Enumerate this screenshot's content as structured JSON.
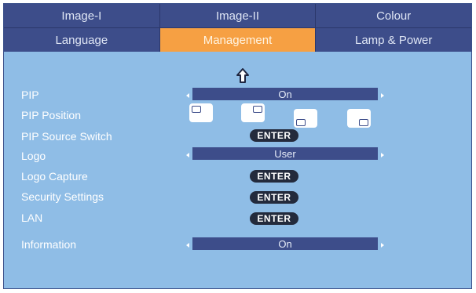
{
  "tabs_row1": [
    "Image-I",
    "Image-II",
    "Colour"
  ],
  "tabs_row2": [
    "Language",
    "Management",
    "Lamp & Power"
  ],
  "active_tab": "Management",
  "menu": {
    "pip": {
      "label": "PIP",
      "value": "On"
    },
    "pip_position": {
      "label": "PIP Position"
    },
    "pip_source_switch": {
      "label": "PIP Source Switch",
      "button": "ENTER"
    },
    "logo": {
      "label": "Logo",
      "value": "User"
    },
    "logo_capture": {
      "label": "Logo Capture",
      "button": "ENTER"
    },
    "security_settings": {
      "label": "Security Settings",
      "button": "ENTER"
    },
    "lan": {
      "label": "LAN",
      "button": "ENTER"
    },
    "information": {
      "label": "Information",
      "value": "On"
    }
  },
  "colors": {
    "panel_background": "#8fbde6",
    "tab_background": "#3d4d8a",
    "active_tab": "#f6a043",
    "enter_button": "#232a3c"
  },
  "icons": {
    "scroll_up": "up-arrow-icon",
    "value_left": "left-arrow-icon",
    "value_right": "right-arrow-icon"
  }
}
